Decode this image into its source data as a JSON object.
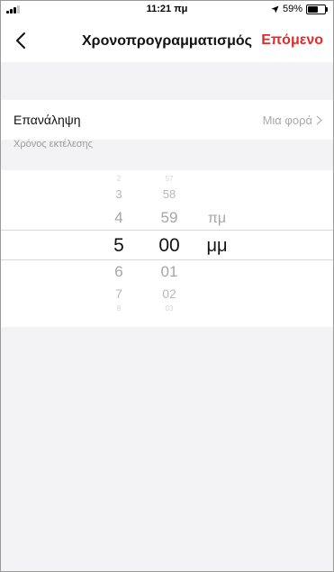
{
  "status": {
    "time": "11:21 πμ",
    "battery": "59%"
  },
  "nav": {
    "title": "Χρονοπρογραμματισμός",
    "next_label": "Επόμενο"
  },
  "repeat": {
    "label": "Επανάληψη",
    "value": "Μια φορά"
  },
  "section": {
    "execution_time_label": "Χρόνος εκτέλεσης"
  },
  "picker": {
    "hours": [
      "2",
      "3",
      "4",
      "5",
      "6",
      "7",
      "8"
    ],
    "minutes": [
      "57",
      "58",
      "59",
      "00",
      "01",
      "02",
      "03"
    ],
    "periods": [
      "πμ",
      "μμ"
    ],
    "selected": {
      "hour": "5",
      "minute": "00",
      "period": "μμ"
    }
  },
  "colors": {
    "accent": "#e02b2b",
    "background": "#f3f3f5",
    "secondary_text": "#a9a9a9"
  }
}
